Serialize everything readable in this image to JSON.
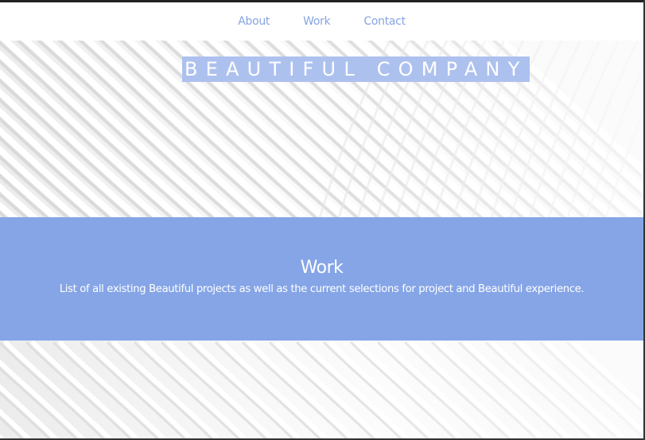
{
  "nav": {
    "items": [
      {
        "label": "About"
      },
      {
        "label": "Work"
      },
      {
        "label": "Contact"
      }
    ]
  },
  "hero": {
    "title": "BEAUTIFUL COMPANY"
  },
  "work_section": {
    "title": "Work",
    "description": "List of all existing Beautiful projects as well as the current selections for project and Beautiful experience."
  },
  "colors": {
    "accent": "#85a5e7",
    "nav_link": "#86a3e3",
    "title_highlight": "#adc1ef"
  }
}
